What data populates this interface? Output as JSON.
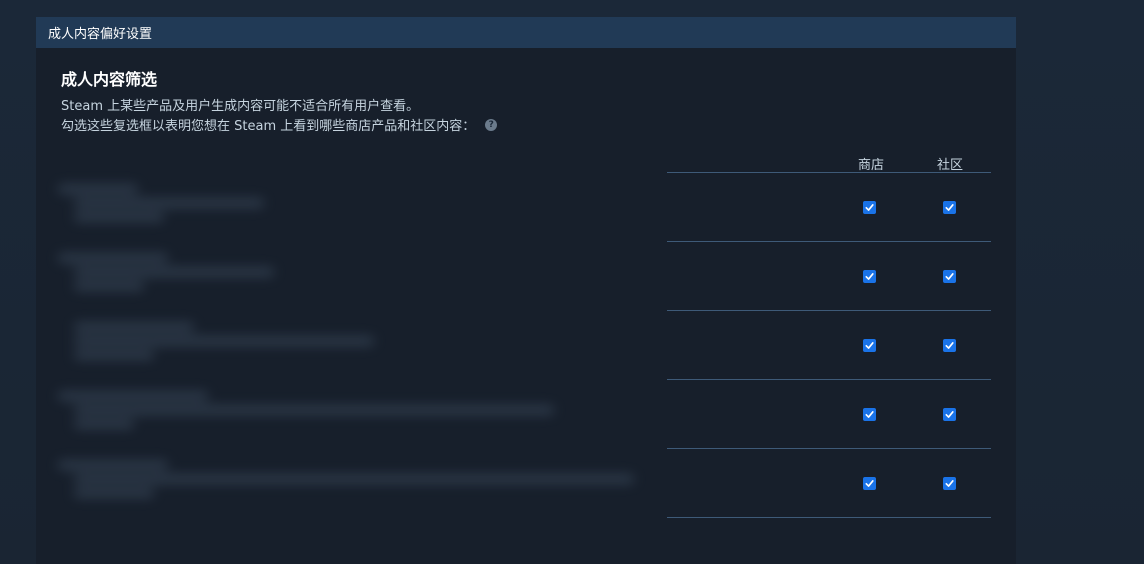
{
  "panel": {
    "header_title": "成人内容偏好设置"
  },
  "section": {
    "title": "成人内容筛选",
    "desc_line1": "Steam 上某些产品及用户生成内容可能不适合所有用户查看。",
    "desc_line2": "勾选这些复选框以表明您想在 Steam 上看到哪些商店产品和社区内容：",
    "help_icon_glyph": "?"
  },
  "columns": {
    "store": "商店",
    "community": "社区"
  },
  "rows": [
    {
      "store_checked": true,
      "community_checked": true
    },
    {
      "store_checked": true,
      "community_checked": true
    },
    {
      "store_checked": true,
      "community_checked": true
    },
    {
      "store_checked": true,
      "community_checked": true
    },
    {
      "store_checked": true,
      "community_checked": true
    }
  ],
  "colors": {
    "page_bg": "#1b2838",
    "panel_bg": "#171f2b",
    "header_bg": "#213a56",
    "checkbox": "#1a73e8",
    "divider": "#3e5a78"
  },
  "icons": {
    "help": "help-icon",
    "checkmark": "checkmark-icon"
  }
}
